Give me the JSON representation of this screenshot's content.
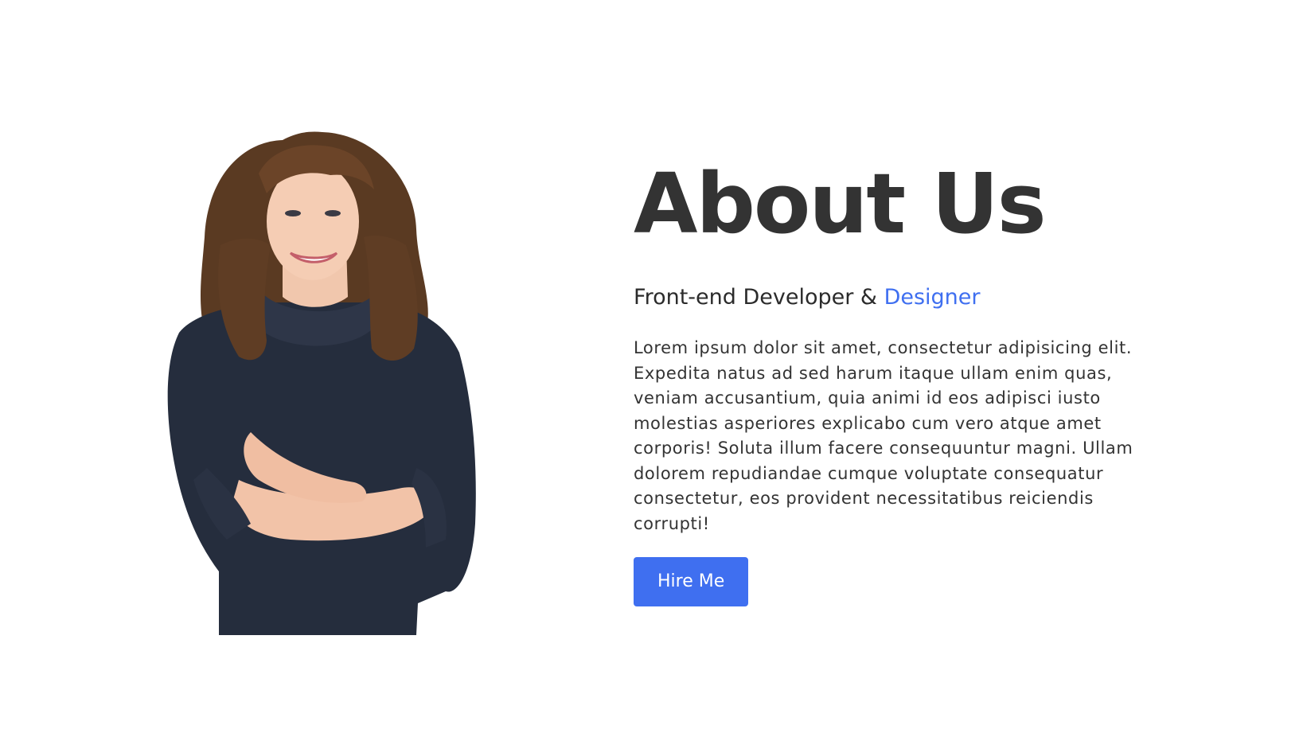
{
  "about": {
    "title": "About Us",
    "role_prefix": "Front-end Developer & ",
    "role_highlight": "Designer",
    "description": "Lorem ipsum dolor sit amet, consectetur adipisicing elit. Expedita natus ad sed harum itaque ullam enim quas, veniam accusantium, quia animi id eos adipisci iusto molestias asperiores explicabo cum vero atque amet corporis! Soluta illum facere consequuntur magni. Ullam dolorem repudiandae cumque voluptate consequatur consectetur, eos provident necessitatibus reiciendis corrupti!",
    "hire_button": "Hire Me"
  },
  "colors": {
    "accent": "#3f6ff0",
    "text": "#333333",
    "background": "#ffffff"
  }
}
